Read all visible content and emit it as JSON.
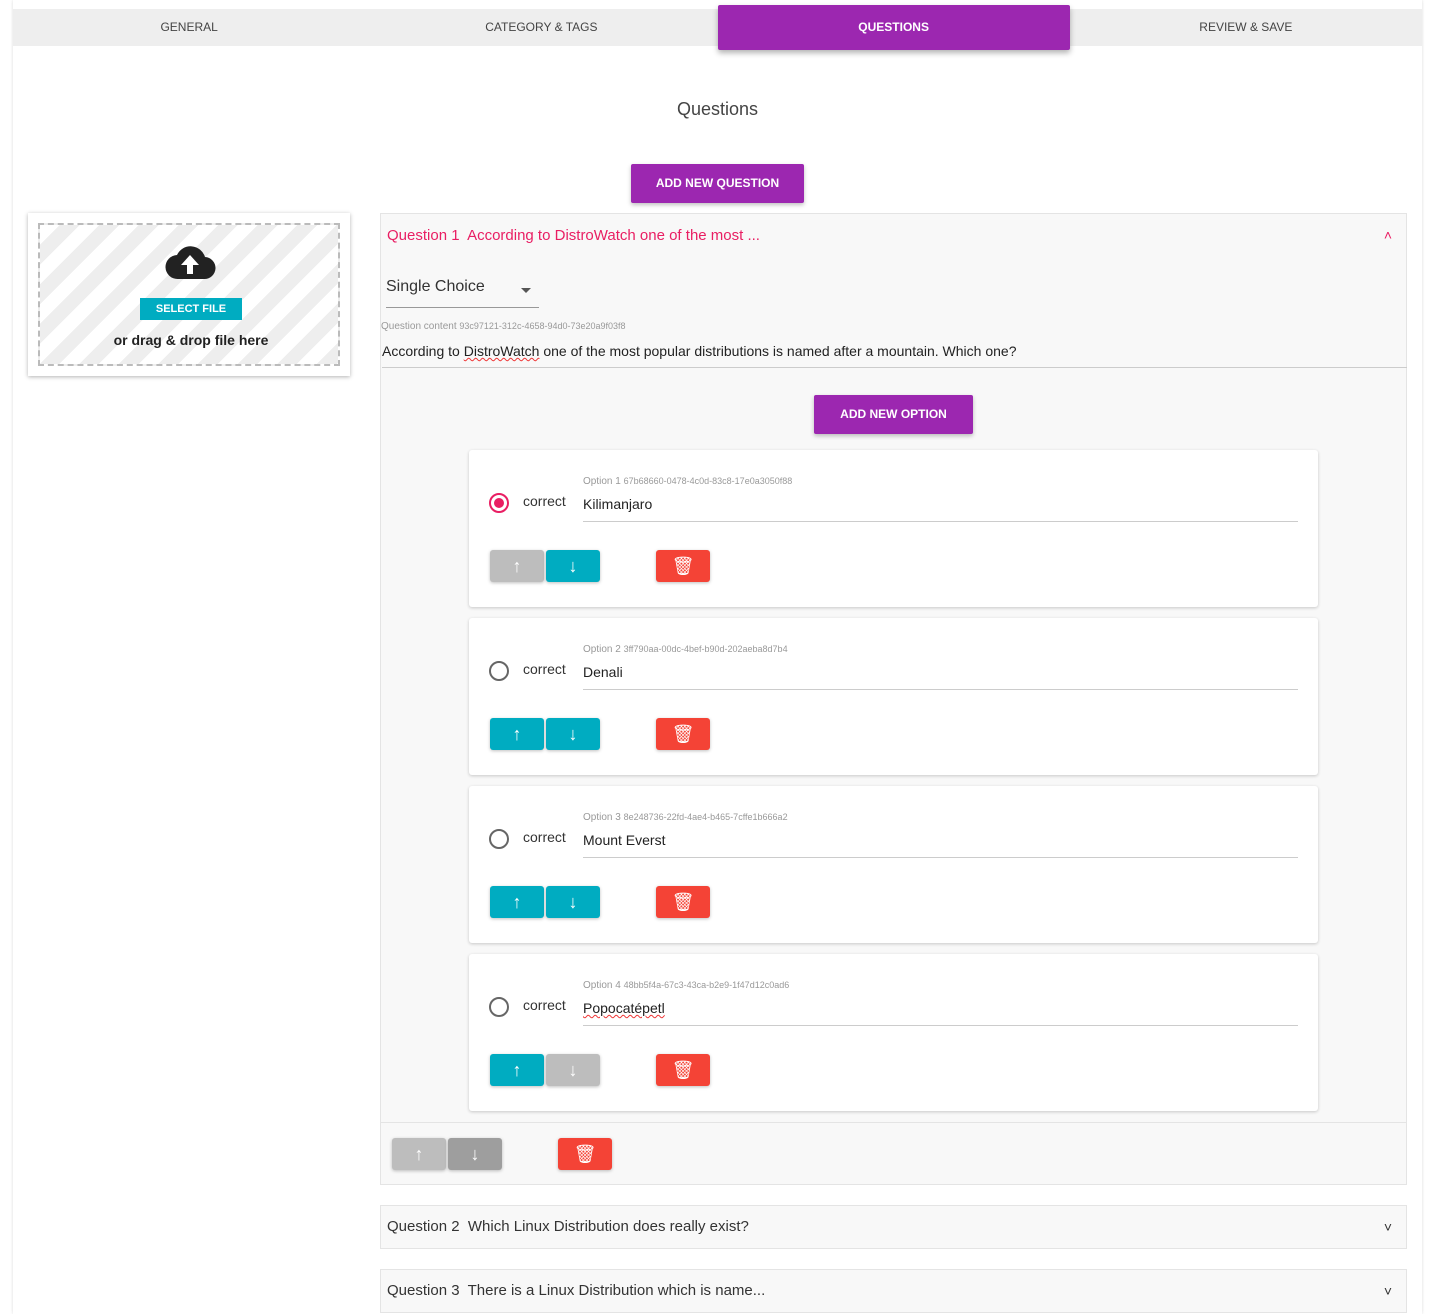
{
  "tabs": [
    "General",
    "Category & Tags",
    "Questions",
    "Review & Save"
  ],
  "active_tab": 2,
  "page_title": "Questions",
  "add_question_label": "ADD NEW QUESTION",
  "upload": {
    "select_label": "SELECT FILE",
    "drop_text": "or drag & drop file here"
  },
  "question1": {
    "prefix": "Question 1",
    "summary": "According to DistroWatch one of the most ...",
    "type": "Single Choice",
    "content_label": "Question content",
    "content_id": "93c97121-312c-4658-94d0-73e20a9f03f8",
    "text_a": "According to ",
    "text_spell": "DistroWatch",
    "text_b": " one of the most popular distributions is named after a mountain. Which one?",
    "add_option_label": "ADD NEW OPTION",
    "correct_label": "correct",
    "options": [
      {
        "label": "Option 1",
        "id": "67b68660-0478-4c0d-83c8-17e0a3050f88",
        "value": "Kilimanjaro",
        "correct": true
      },
      {
        "label": "Option 2",
        "id": "3ff790aa-00dc-4bef-b90d-202aeba8d7b4",
        "value": "Denali",
        "correct": false
      },
      {
        "label": "Option 3",
        "id": "8e248736-22fd-4ae4-b465-7cffe1b666a2",
        "value": "Mount Everst",
        "correct": false
      },
      {
        "label": "Option 4",
        "id": "48bb5f4a-67c3-43ca-b2e9-1f47d12c0ad6",
        "value": "Popocatépetl",
        "correct": false
      }
    ]
  },
  "collapsed_questions": [
    {
      "prefix": "Question 2",
      "summary": "Which Linux Distribution does really exist?"
    },
    {
      "prefix": "Question 3",
      "summary": "There is a Linux Distribution which is name..."
    }
  ],
  "colors": {
    "accent": "#9c27b0",
    "teal": "#00acc1",
    "danger": "#f44336",
    "pink": "#e91e63"
  }
}
